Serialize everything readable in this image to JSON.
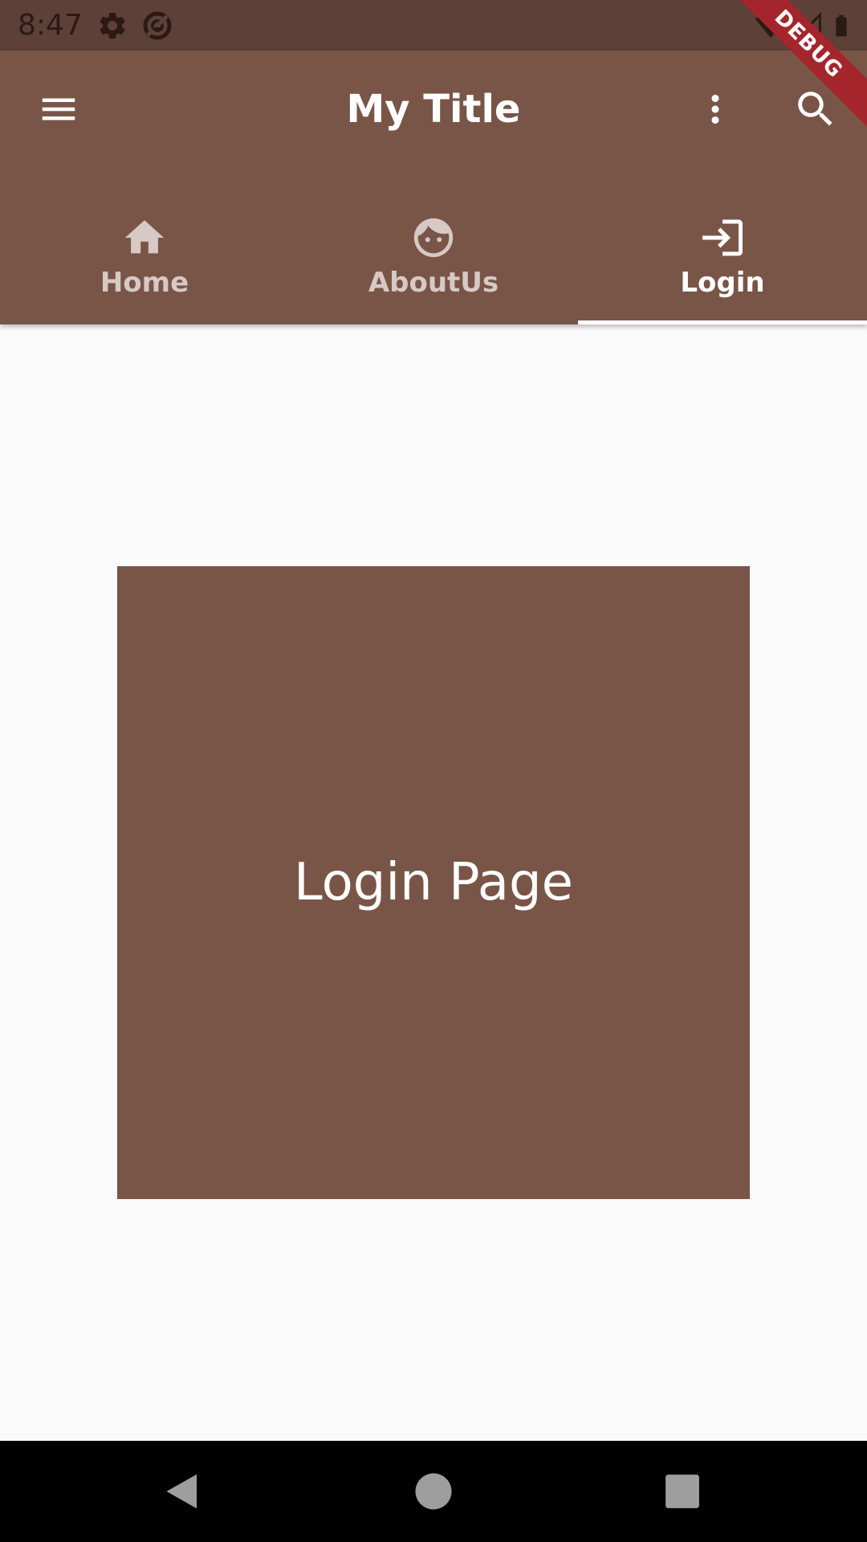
{
  "status_bar": {
    "time": "8:47",
    "icons": [
      "gear-icon",
      "data-saver-icon",
      "wifi-icon",
      "cell-signal-icon",
      "battery-icon"
    ],
    "color": "#5d4037"
  },
  "debug_banner": {
    "label": "DEBUG",
    "color": "#a4262c"
  },
  "app_bar": {
    "title": "My Title",
    "color": "#795548",
    "leading_icon": "menu-icon",
    "actions": [
      "more-vert-icon",
      "search-icon"
    ]
  },
  "tabs": [
    {
      "label": "Home",
      "icon": "home-icon",
      "active": false
    },
    {
      "label": "AboutUs",
      "icon": "face-icon",
      "active": false
    },
    {
      "label": "Login",
      "icon": "login-icon",
      "active": true
    }
  ],
  "content": {
    "text": "Login Page",
    "box_color": "#795548"
  },
  "nav_bar": {
    "buttons": [
      "back-icon",
      "home-circle-icon",
      "recents-icon"
    ]
  }
}
